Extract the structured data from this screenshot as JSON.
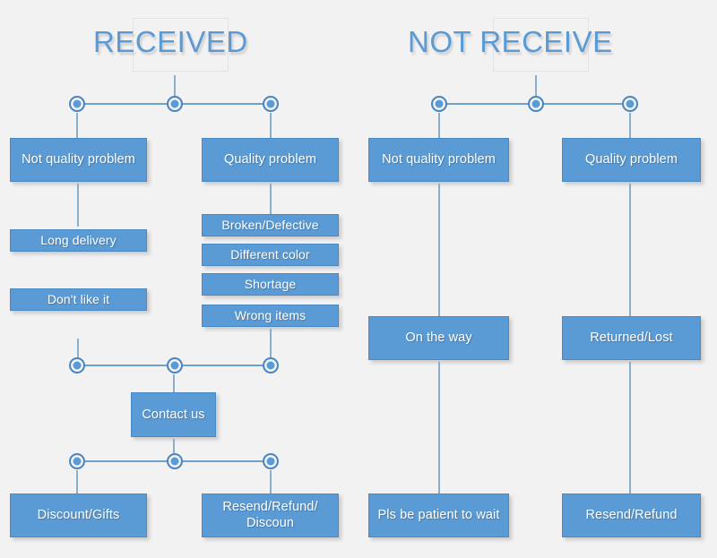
{
  "diagram": {
    "title_left": "RECEIVED",
    "title_right": "NOT RECEIVE",
    "colors": {
      "background": "#f3f2f3",
      "box_fill": "#5b9bd5",
      "box_text": "#ffffff",
      "title_text": "#5b9bd5",
      "connector": "#7ca5ca"
    },
    "left_branch": {
      "heading": "RECEIVED",
      "option_a": "Not quality problem",
      "option_b": "Quality problem",
      "not_quality_reasons": [
        "Long delivery",
        "Don't like it"
      ],
      "quality_reasons": [
        "Broken/Defective",
        "Different color",
        "Shortage",
        "Wrong items"
      ],
      "action": "Contact us",
      "outcome_a": "Discount/Gifts",
      "outcome_b": "Resend/Refund/\nDiscoun",
      "outcome_b_line1": "Resend/Refund/",
      "outcome_b_line2": "Discoun"
    },
    "right_branch": {
      "heading": "NOT RECEIVE",
      "option_a": "Not quality problem",
      "option_b": "Quality problem",
      "status_a": "On the way",
      "status_b": "Returned/Lost",
      "outcome_a": "Pls be patient to wait",
      "outcome_b": "Resend/Refund"
    }
  }
}
